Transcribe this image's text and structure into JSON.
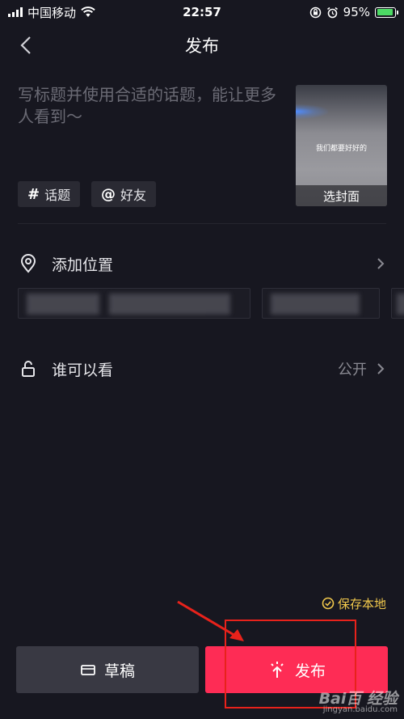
{
  "status_bar": {
    "carrier": "中国移动",
    "time": "22:57",
    "battery": "95%",
    "battery_level": 0.95
  },
  "nav": {
    "title": "发布",
    "back_icon": "chevron-left-icon"
  },
  "caption": {
    "placeholder": "写标题并使用合适的话题，能让更多人看到～"
  },
  "cover": {
    "overlay_text": "我们都要好好的",
    "label": "选封面"
  },
  "chips": [
    {
      "icon": "#",
      "label": "话题"
    },
    {
      "icon": "@",
      "label": "好友"
    }
  ],
  "location_row": {
    "label": "添加位置",
    "icon": "location-pin-icon"
  },
  "visibility_row": {
    "label": "谁可以看",
    "value": "公开",
    "icon": "unlock-icon"
  },
  "save_local": {
    "label": "保存本地",
    "checked": true
  },
  "buttons": {
    "draft": "草稿",
    "publish": "发布"
  },
  "watermark": {
    "logo": "Bai百 经验",
    "url": "jingyan.baidu.com"
  },
  "colors": {
    "background": "#171720",
    "accent": "#fe2c55",
    "save_local": "#f2c94c",
    "annotation": "#e8221b"
  }
}
